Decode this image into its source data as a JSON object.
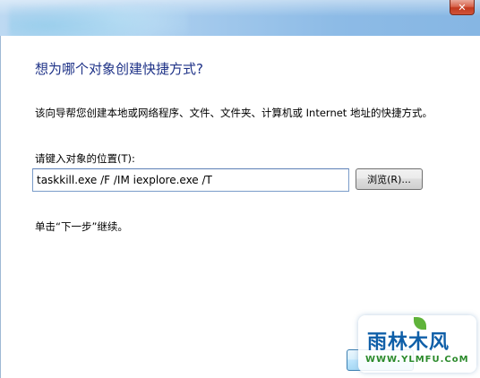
{
  "window": {
    "close_icon": "close-icon"
  },
  "wizard": {
    "heading": "想为哪个对象创建快捷方式?",
    "description": "该向导帮您创建本地或网络程序、文件、文件夹、计算机或 Internet 地址的快捷方式。",
    "location_label": "请键入对象的位置(T):",
    "location_value": "taskkill.exe /F /IM iexplore.exe /T",
    "browse_label": "浏览(R)...",
    "hint": "单击“下一步”继续。"
  },
  "watermark": {
    "name": "雨林木风",
    "url": "WWW.YLMFU.CoM"
  },
  "colors": {
    "heading": "#1e3287",
    "titlebar": "#a9cdee",
    "close_button": "#c23a1f"
  }
}
